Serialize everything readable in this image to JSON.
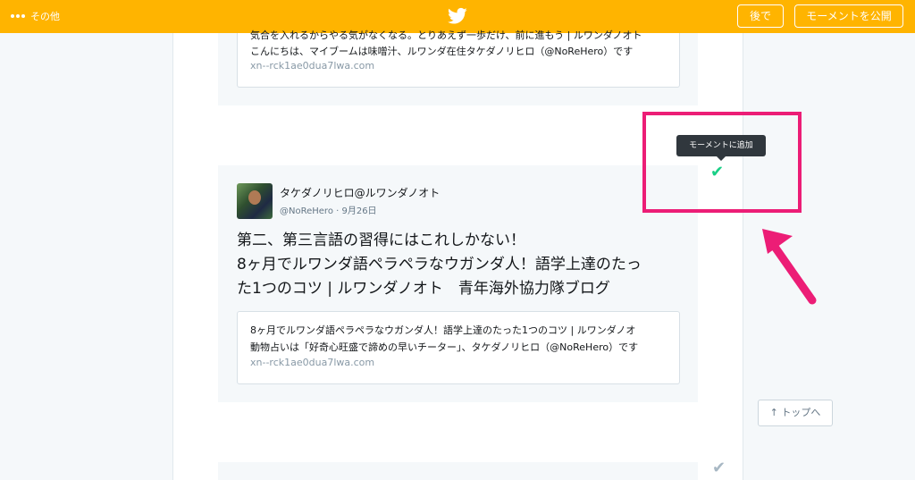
{
  "topbar": {
    "more_label": "その他",
    "later_label": "後で",
    "publish_label": "モーメントを公開",
    "background_color": "#ffb400"
  },
  "card_top": {
    "line1": "気合を入れるからやる気がなくなる。とりあえず一歩だけ、前に進もう | ルワンダノオト",
    "line2": "こんにちは、マイブームは味噌汁、ルワンダ在住タケダノリヒロ（@NoReHero）です",
    "url": "xn--rck1ae0dua7lwa.com"
  },
  "tweet": {
    "author_name": "タケダノリヒロ@ルワンダノオト",
    "meta": "@NoReHero · 9月26日",
    "text_lines": [
      "第二、第三言語の習得にはこれしかない！",
      "8ヶ月でルワンダ語ペラペラなウガンダ人！語学上達のたっ",
      "た1つのコツ | ルワンダノオト　青年海外協力隊ブログ"
    ],
    "card": {
      "line1": "8ヶ月でルワンダ語ペラペラなウガンダ人！語学上達のたった1つのコツ | ルワンダノオ",
      "line2": "動物占いは「好奇心旺盛で諦めの早いチーター」、タケダノリヒロ（@NoReHero）です",
      "url": "xn--rck1ae0dua7lwa.com"
    }
  },
  "tooltip": {
    "text": "モーメントに追加"
  },
  "icons": {
    "check_added": "✔",
    "check_default": "✔",
    "arrow_up": "↑"
  },
  "back_to_top": {
    "label": "トップへ"
  },
  "colors": {
    "accent": "#ffb400",
    "check_green": "#19cf86",
    "highlight": "#ec1d76"
  }
}
